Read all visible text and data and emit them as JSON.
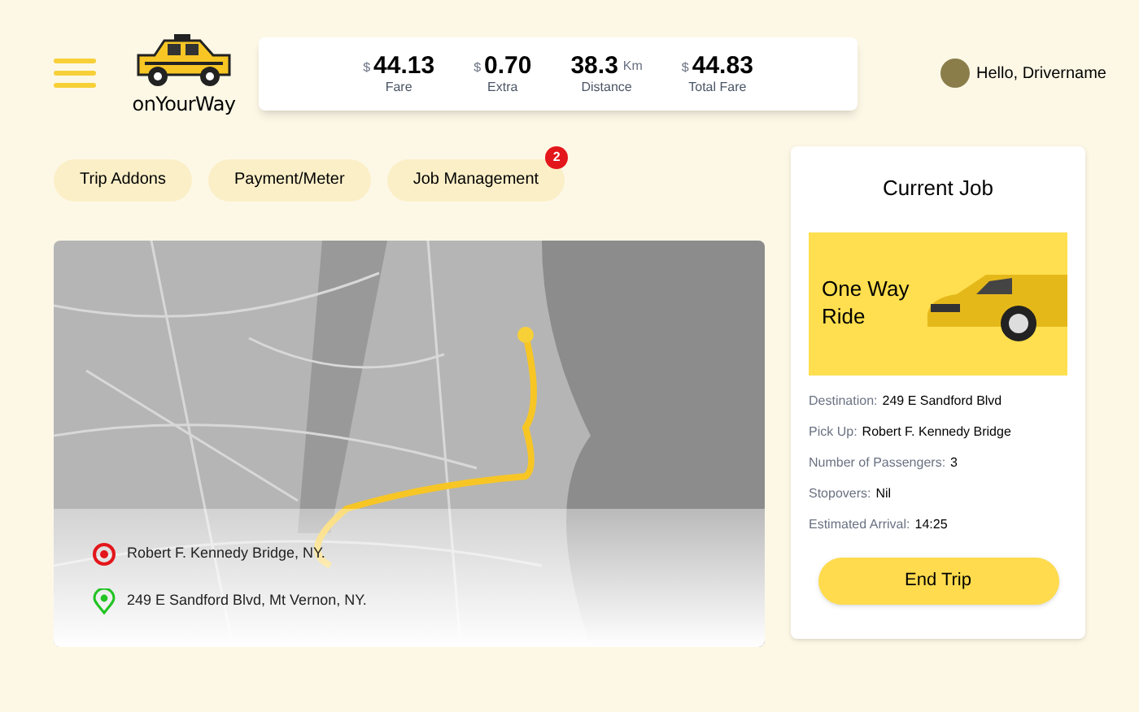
{
  "logo": {
    "text": "onYourWay"
  },
  "stats": [
    {
      "currency": "$",
      "value": "44.13",
      "label": "Fare"
    },
    {
      "currency": "$",
      "value": "0.70",
      "label": "Extra"
    },
    {
      "value": "38.3",
      "unit": "Km",
      "label": "Distance"
    },
    {
      "currency": "$",
      "value": "44.83",
      "label": "Total Fare"
    }
  ],
  "user": {
    "greeting": "Hello, Drivername"
  },
  "tabs": [
    {
      "label": "Trip Addons"
    },
    {
      "label": "Payment/Meter"
    },
    {
      "label": "Job Management",
      "badge": "2"
    }
  ],
  "map": {
    "stops": [
      {
        "kind": "origin",
        "label": "Robert F. Kennedy Bridge, NY."
      },
      {
        "kind": "destination",
        "label": "249 E Sandford Blvd, Mt Vernon, NY."
      }
    ]
  },
  "current_job": {
    "title": "Current Job",
    "banner": "One Way Ride",
    "details": [
      {
        "label": "Destination:",
        "value": "249 E Sandford Blvd"
      },
      {
        "label": "Pick Up:",
        "value": "Robert F. Kennedy Bridge"
      },
      {
        "label": "Number of Passengers:",
        "value": "3"
      },
      {
        "label": "Stopovers:",
        "value": "Nil"
      },
      {
        "label": "Estimated Arrival:",
        "value": "14:25"
      }
    ],
    "button": "End Trip"
  }
}
